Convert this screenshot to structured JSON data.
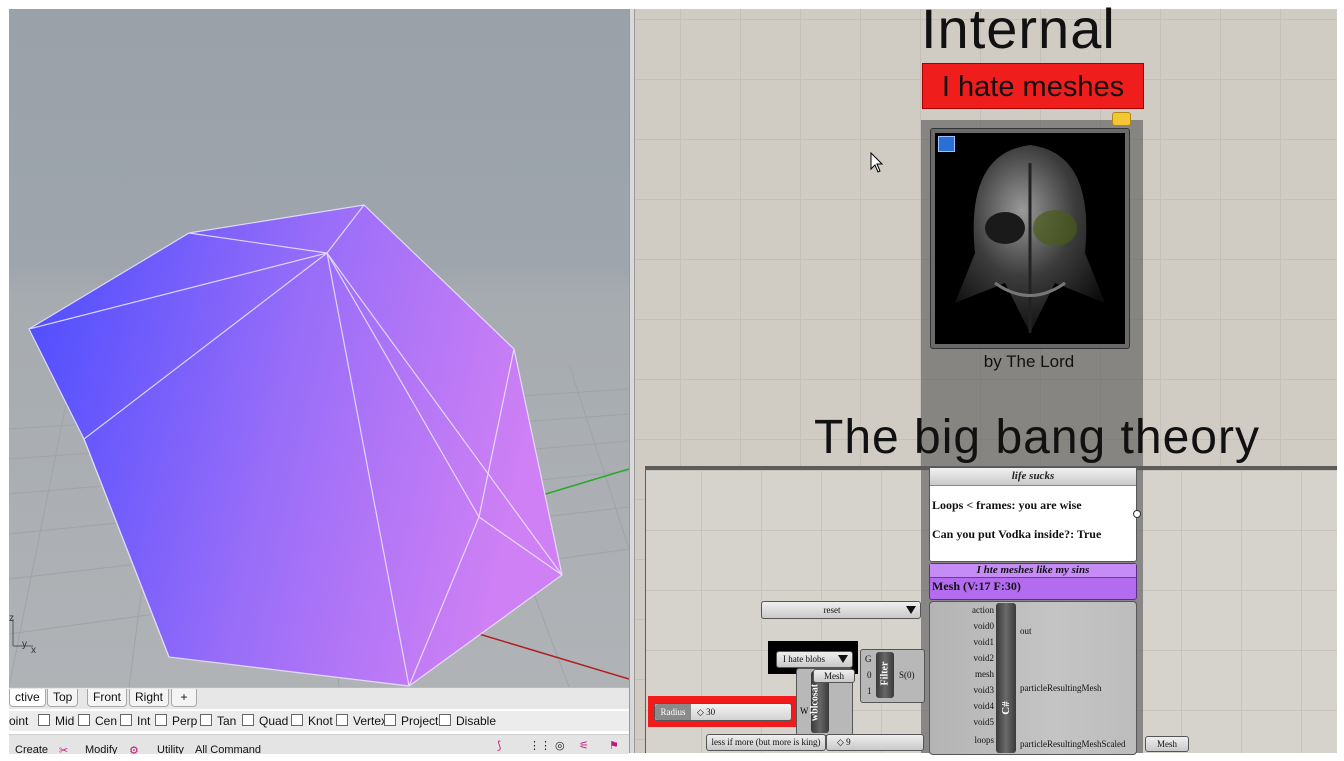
{
  "rhino": {
    "viewport_tabs": [
      "ctive",
      "Top",
      "Front",
      "Right"
    ],
    "add_tab_icon": "plus-icon",
    "axis_labels": {
      "x": "x",
      "y": "y",
      "z": "z"
    },
    "osnaps": [
      "oint",
      "Mid",
      "Cen",
      "Int",
      "Perp",
      "Tan",
      "Quad",
      "Knot",
      "Vertex",
      "Project",
      "Disable"
    ],
    "command_tabs": [
      "Create",
      "Modify",
      "Utility",
      "All Command"
    ],
    "mesh_colors": {
      "dark": "#4c4cff",
      "light": "#c77cf5"
    }
  },
  "grasshopper": {
    "title_internal": "Internal",
    "banner": "I hate meshes",
    "banner_color": "#f01d1d",
    "image_caption": "by The Lord",
    "title_bigbang": "The big bang theory",
    "panel": {
      "title": "life sucks",
      "line1": "Loops < frames: you are wise",
      "line2": "Can you put Vodka inside?: True"
    },
    "mesh_param": {
      "title": "I hte meshes like my sins",
      "value": "Mesh (V:17  F:30)",
      "color": "#b36cf0"
    },
    "csharp": {
      "label": "C#",
      "inputs": [
        "action",
        "void0",
        "void1",
        "void2",
        "mesh",
        "void3",
        "void4",
        "void5",
        "loops"
      ],
      "outputs": [
        "out",
        "particleResultingMesh",
        "particleResultingMeshScaled"
      ]
    },
    "reset_button": "reset",
    "blobs_dropdown": "I hate blobs",
    "radius_slider": {
      "label": "Radius",
      "value": "30"
    },
    "wbl_component": {
      "label": "wblcosat",
      "input": "W",
      "tag": "Mesh"
    },
    "filter_component": {
      "label": "Filter",
      "inputs": [
        "G",
        "0",
        "1"
      ],
      "output": "S(0)"
    },
    "gene_slider": {
      "label": "less if more (but more is king)",
      "value": "9"
    },
    "mesh_output_param": "Mesh"
  }
}
